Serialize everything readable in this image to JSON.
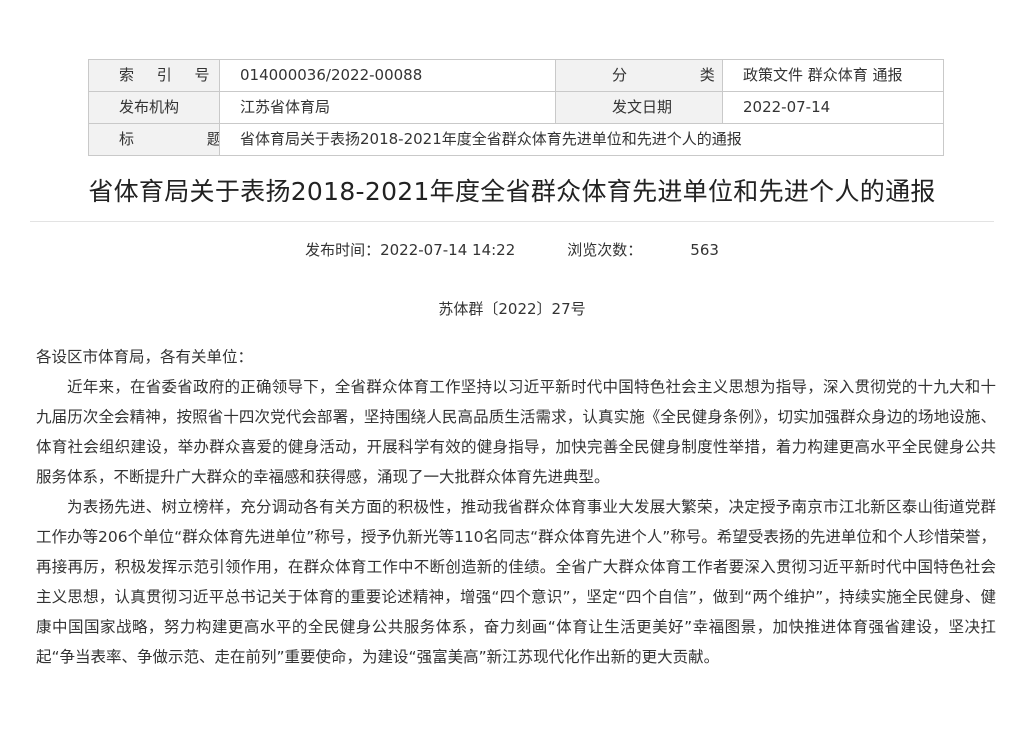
{
  "meta": {
    "index_label": "索 引 号",
    "index_value": "014000036/2022-00088",
    "category_label": "分 类",
    "category_value": "政策文件 群众体育 通报",
    "issuer_label": "发布机构",
    "issuer_value": "江苏省体育局",
    "date_label": "发文日期",
    "date_value": "2022-07-14",
    "subject_label": "标 题",
    "subject_value": "省体育局关于表扬2018-2021年度全省群众体育先进单位和先进个人的通报"
  },
  "article": {
    "title": "省体育局关于表扬2018-2021年度全省群众体育先进单位和先进个人的通报",
    "publish_label": "发布时间：",
    "publish_time": "2022-07-14 14:22",
    "views_label": "浏览次数：",
    "views_count": "563",
    "doc_number": "苏体群〔2022〕27号",
    "salutation": "各设区市体育局，各有关单位：",
    "paragraph_1": "近年来，在省委省政府的正确领导下，全省群众体育工作坚持以习近平新时代中国特色社会主义思想为指导，深入贯彻党的十九大和十九届历次全会精神，按照省十四次党代会部署，坚持围绕人民高品质生活需求，认真实施《全民健身条例》，切实加强群众身边的场地设施、体育社会组织建设，举办群众喜爱的健身活动，开展科学有效的健身指导，加快完善全民健身制度性举措，着力构建更高水平全民健身公共服务体系，不断提升广大群众的幸福感和获得感，涌现了一大批群众体育先进典型。",
    "paragraph_2": "为表扬先进、树立榜样，充分调动各有关方面的积极性，推动我省群众体育事业大发展大繁荣，决定授予南京市江北新区泰山街道党群工作办等206个单位“群众体育先进单位”称号，授予仇新光等110名同志“群众体育先进个人”称号。希望受表扬的先进单位和个人珍惜荣誉，再接再厉，积极发挥示范引领作用，在群众体育工作中不断创造新的佳绩。全省广大群众体育工作者要深入贯彻习近平新时代中国特色社会主义思想，认真贯彻习近平总书记关于体育的重要论述精神，增强“四个意识”，坚定“四个自信”，做到“两个维护”，持续实施全民健身、健康中国国家战略，努力构建更高水平的全民健身公共服务体系，奋力刻画“体育让生活更美好”幸福图景，加快推进体育强省建设，坚决扛起“争当表率、争做示范、走在前列”重要使命，为建设“强富美高”新江苏现代化作出新的更大贡献。"
  }
}
